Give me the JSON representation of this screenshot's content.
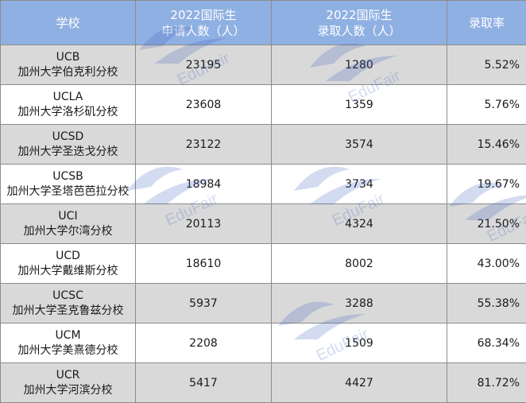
{
  "header": {
    "school": "学校",
    "applicants_line1": "2022国际生",
    "applicants_line2": "申请人数（人）",
    "admitted_line1": "2022国际生",
    "admitted_line2": "录取人数（人）",
    "rate": "录取率"
  },
  "rows": [
    {
      "code": "UCB",
      "name": "加州大学伯克利分校",
      "applicants": "23195",
      "admitted": "1280",
      "rate": "5.52%"
    },
    {
      "code": "UCLA",
      "name": "加州大学洛杉矶分校",
      "applicants": "23608",
      "admitted": "1359",
      "rate": "5.76%"
    },
    {
      "code": "UCSD",
      "name": "加州大学圣迭戈分校",
      "applicants": "23122",
      "admitted": "3574",
      "rate": "15.46%"
    },
    {
      "code": "UCSB",
      "name": "加州大学圣塔芭芭拉分校",
      "applicants": "18984",
      "admitted": "3734",
      "rate": "19.67%"
    },
    {
      "code": "UCI",
      "name": "加州大学尔湾分校",
      "applicants": "20113",
      "admitted": "4324",
      "rate": "21.50%"
    },
    {
      "code": "UCD",
      "name": "加州大学戴维斯分校",
      "applicants": "18610",
      "admitted": "8002",
      "rate": "43.00%"
    },
    {
      "code": "UCSC",
      "name": "加州大学圣克鲁兹分校",
      "applicants": "5937",
      "admitted": "3288",
      "rate": "55.38%"
    },
    {
      "code": "UCM",
      "name": "加州大学美熹德分校",
      "applicants": "2208",
      "admitted": "1509",
      "rate": "68.34%"
    },
    {
      "code": "UCR",
      "name": "加州大学河滨分校",
      "applicants": "5417",
      "admitted": "4427",
      "rate": "81.72%"
    }
  ],
  "watermark": {
    "text": "EduFair",
    "color": "#3a5fc0"
  }
}
